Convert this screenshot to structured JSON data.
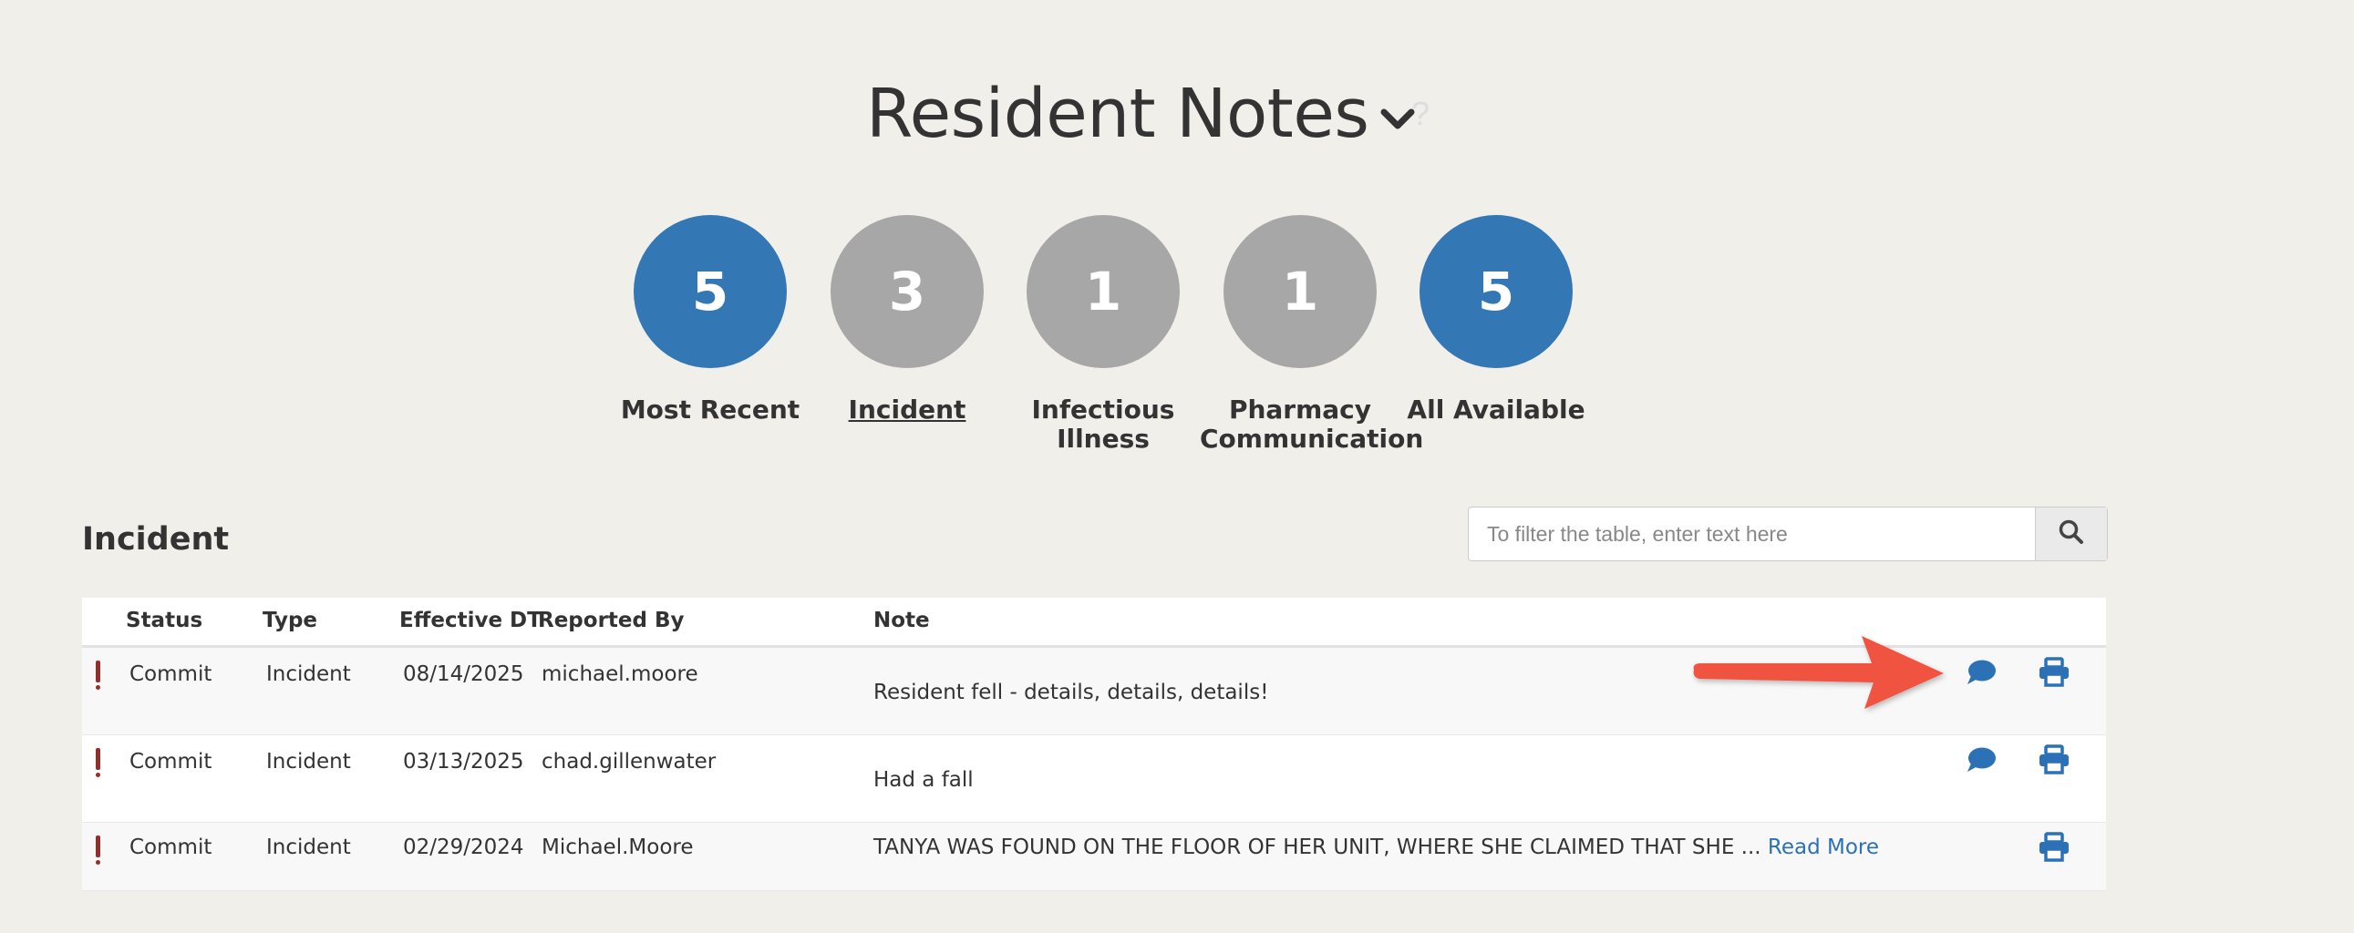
{
  "header": {
    "title": "Resident Notes",
    "help": "?"
  },
  "categories": [
    {
      "count": "5",
      "label": "Most Recent",
      "color": "#3477b5",
      "active": false
    },
    {
      "count": "3",
      "label": "Incident",
      "color": "#a7a7a7",
      "active": true
    },
    {
      "count": "1",
      "label_line1": "Infectious",
      "label_line2": "Illness",
      "color": "#a7a7a7",
      "active": false
    },
    {
      "count": "1",
      "label_line1": "Pharmacy",
      "label_line2": "Communication",
      "color": "#a7a7a7",
      "active": false
    },
    {
      "count": "5",
      "label": "All Available",
      "color": "#3477b5",
      "active": false
    }
  ],
  "section": {
    "title": "Incident"
  },
  "search": {
    "placeholder": "To filter the table, enter text here"
  },
  "table": {
    "columns": [
      "Status",
      "Type",
      "Effective DT",
      "Reported By",
      "Note"
    ],
    "rows": [
      {
        "status": "Commit",
        "type": "Incident",
        "date": "08/14/2025",
        "reported_by": "michael.moore",
        "note": "Resident fell - details, details, details!"
      },
      {
        "status": "Commit",
        "type": "Incident",
        "date": "03/13/2025",
        "reported_by": "chad.gillenwater",
        "note": "Had a fall"
      },
      {
        "status": "Commit",
        "type": "Incident",
        "date": "02/29/2024",
        "reported_by": "Michael.Moore",
        "note": "TANYA WAS FOUND ON THE FLOOR OF HER UNIT, WHERE SHE CLAIMED THAT SHE ...",
        "read_more": "Read More"
      }
    ]
  },
  "colors": {
    "accent": "#3477b5",
    "status_red": "#9a2b2b",
    "arrow": "#f0523f",
    "background": "#f1efea"
  },
  "icons": [
    "chevron-down-icon",
    "help-icon",
    "search-icon",
    "comment-icon",
    "print-icon",
    "status-exclamation-icon",
    "arrow-annotation"
  ]
}
